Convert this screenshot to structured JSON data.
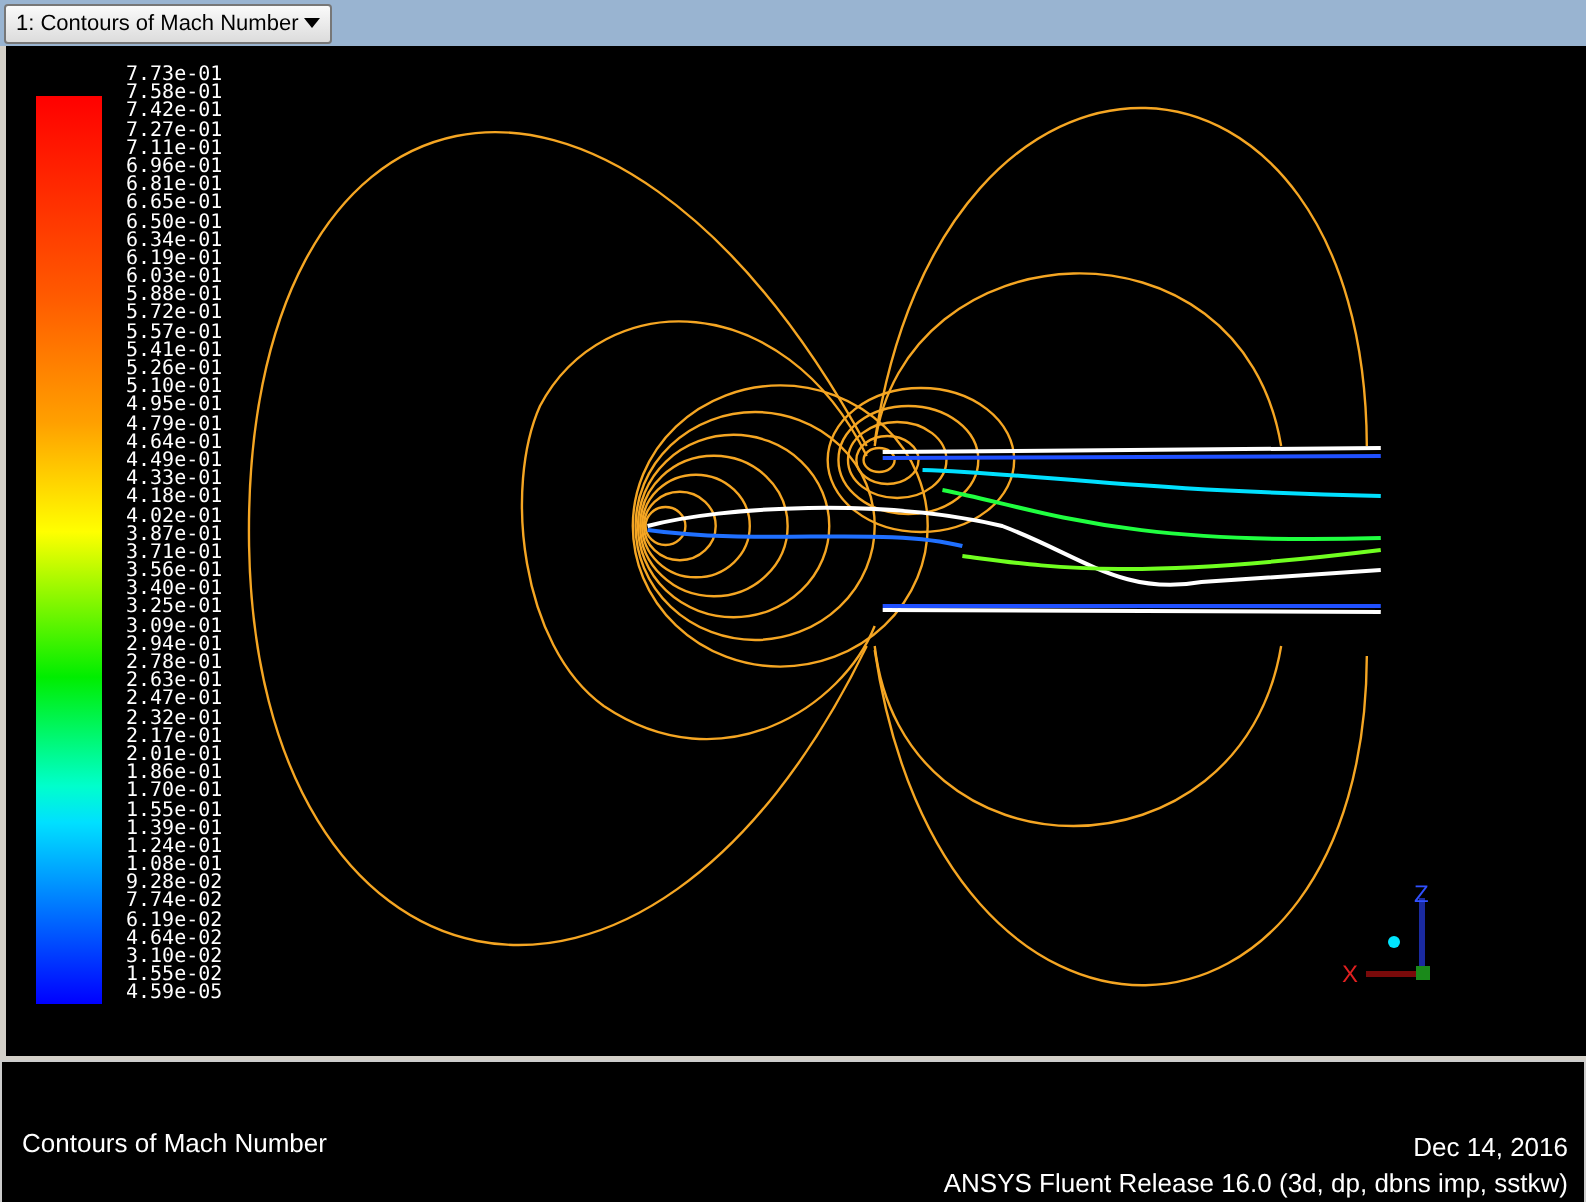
{
  "window_selector": {
    "value": "1: Contours of Mach Number"
  },
  "colorbar": {
    "labels": [
      "7.73e-01",
      "7.58e-01",
      "7.42e-01",
      "7.27e-01",
      "7.11e-01",
      "6.96e-01",
      "6.81e-01",
      "6.65e-01",
      "6.50e-01",
      "6.34e-01",
      "6.19e-01",
      "6.03e-01",
      "5.88e-01",
      "5.72e-01",
      "5.57e-01",
      "5.41e-01",
      "5.26e-01",
      "5.10e-01",
      "4.95e-01",
      "4.79e-01",
      "4.64e-01",
      "4.49e-01",
      "4.33e-01",
      "4.18e-01",
      "4.02e-01",
      "3.87e-01",
      "3.71e-01",
      "3.56e-01",
      "3.40e-01",
      "3.25e-01",
      "3.09e-01",
      "2.94e-01",
      "2.78e-01",
      "2.63e-01",
      "2.47e-01",
      "2.32e-01",
      "2.17e-01",
      "2.01e-01",
      "1.86e-01",
      "1.70e-01",
      "1.55e-01",
      "1.39e-01",
      "1.24e-01",
      "1.08e-01",
      "9.28e-02",
      "7.74e-02",
      "6.19e-02",
      "4.64e-02",
      "3.10e-02",
      "1.55e-02",
      "4.59e-05"
    ]
  },
  "axes_triad": {
    "x_label": "X",
    "z_label": "Z"
  },
  "footer": {
    "title": "Contours of Mach Number",
    "date": "Dec 14, 2016",
    "release": "ANSYS Fluent Release 16.0 (3d, dp, dbns imp, sstkw)"
  }
}
